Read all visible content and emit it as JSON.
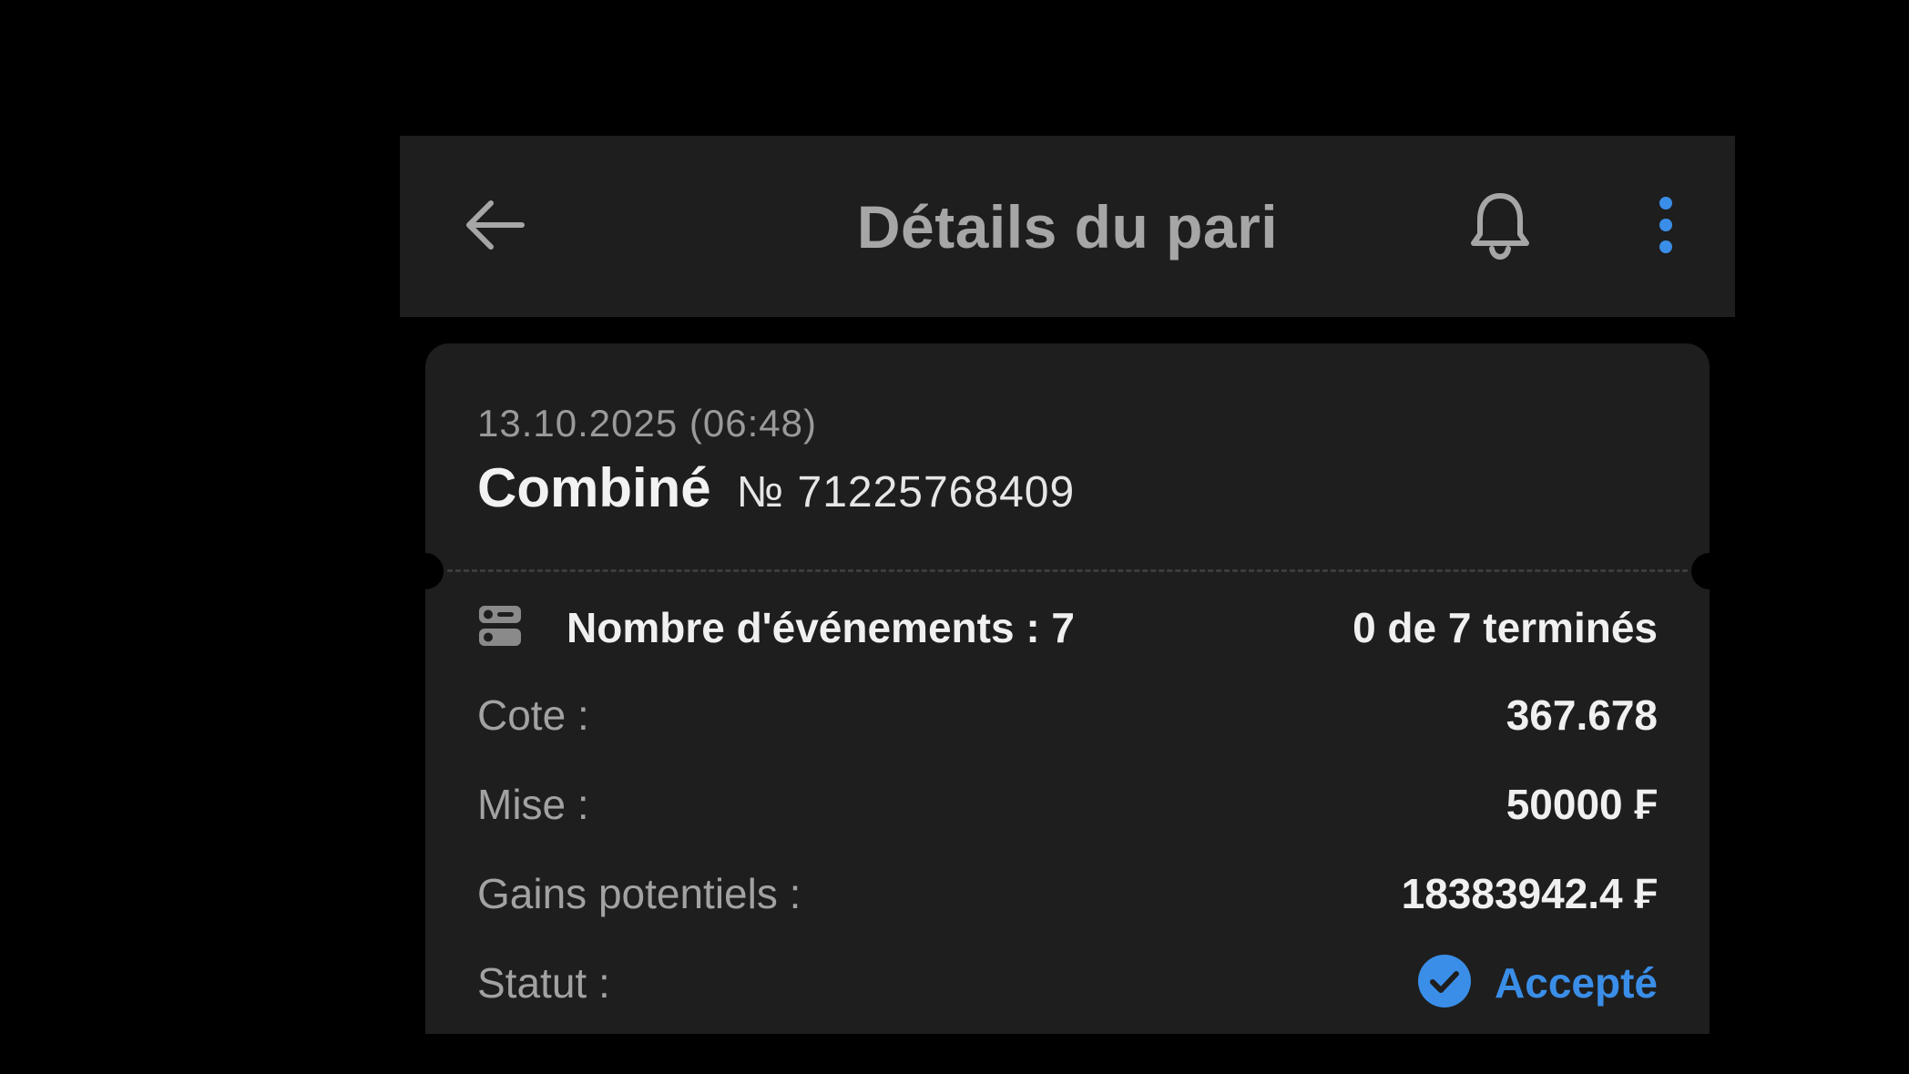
{
  "header": {
    "title": "Détails du pari",
    "back_icon": "arrow-left-icon",
    "bell_icon": "bell-icon",
    "more_icon": "more-vertical-icon"
  },
  "bet": {
    "date": "13.10.2025 (06:48)",
    "type": "Combiné",
    "number": "№ 71225768409",
    "events_icon": "events-list-icon",
    "events_label": "Nombre d'événements : 7",
    "events_status": "0 de 7 terminés",
    "odds_label": "Cote :",
    "odds_value": "367.678",
    "stake_label": "Mise :",
    "stake_value": "50000 ₣",
    "potential_label": "Gains potentiels :",
    "potential_value": "18383942.4 ₣",
    "status_label": "Statut :",
    "status_value": "Accepté",
    "status_icon": "check-circle-icon"
  },
  "colors": {
    "background": "#000000",
    "surface": "#1e1e1e",
    "accent": "#3a8ee8",
    "text_primary": "#f0f0f0",
    "text_secondary": "#a2a2a2"
  }
}
